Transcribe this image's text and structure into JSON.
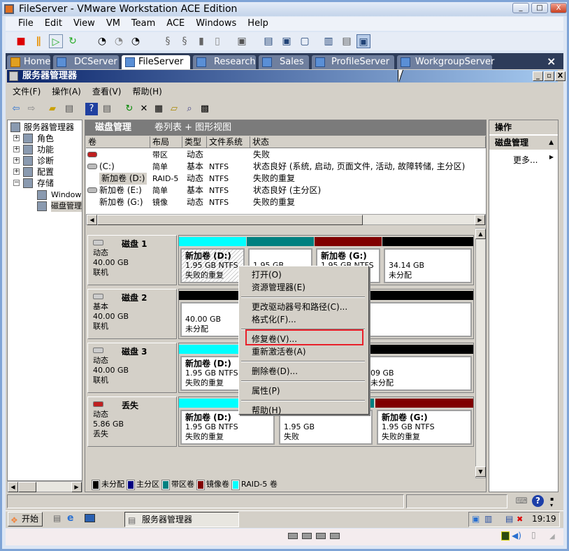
{
  "window": {
    "title": "FileServer - VMware Workstation ACE Edition",
    "min": "_",
    "max": "□",
    "close": "X"
  },
  "menubar": [
    "File",
    "Edit",
    "View",
    "VM",
    "Team",
    "ACE",
    "Windows",
    "Help"
  ],
  "toolbar_icons": [
    "stop-icon",
    "pause-icon",
    "play-icon",
    "reset-icon",
    "snapshot-icon",
    "revert-icon",
    "snapshot-manager-icon",
    "team-icon-1",
    "team-icon-2",
    "device-icon",
    "usb-icon",
    "console-icon",
    "quick-switch-icon",
    "fullscreen-icon",
    "unity-icon",
    "settings-icon",
    "summary-icon",
    "console-view-icon"
  ],
  "tabs": [
    {
      "label": "Home"
    },
    {
      "label": "DCServer"
    },
    {
      "label": "FileServer",
      "active": true
    },
    {
      "label": "Research"
    },
    {
      "label": "Sales"
    },
    {
      "label": "ProfileServer"
    },
    {
      "label": "WorkgroupServer"
    }
  ],
  "tabs_close": "×",
  "app": {
    "title": "服务器管理器",
    "min": "_",
    "restore": "▫",
    "close": "X",
    "menu": [
      "文件(F)",
      "操作(A)",
      "查看(V)",
      "帮助(H)"
    ]
  },
  "tree": {
    "root": "服务器管理器",
    "items": [
      {
        "label": "角色",
        "expander": "+"
      },
      {
        "label": "功能",
        "expander": "+"
      },
      {
        "label": "诊断",
        "expander": "+"
      },
      {
        "label": "配置",
        "expander": "+"
      },
      {
        "label": "存储",
        "expander": "−"
      },
      {
        "label": "Windows"
      },
      {
        "label": "磁盘管理",
        "selected": true
      }
    ]
  },
  "center": {
    "title": "磁盘管理",
    "view": "卷列表 + 图形视图"
  },
  "volume_list": {
    "columns": [
      "卷",
      "布局",
      "类型",
      "文件系统",
      "状态"
    ],
    "rows": [
      {
        "volume": "",
        "layout": "带区",
        "type": "动态",
        "fs": "",
        "status": "失败",
        "icon": "failed-disk-icon"
      },
      {
        "volume": "(C:)",
        "layout": "简单",
        "type": "基本",
        "fs": "NTFS",
        "status": "状态良好 (系统, 启动, 页面文件, 活动, 故障转储, 主分区)",
        "icon": "disk-icon"
      },
      {
        "volume": "新加卷 (D:)",
        "layout": "RAID-5",
        "type": "动态",
        "fs": "NTFS",
        "status": "失败的重复",
        "icon": "",
        "selected": true
      },
      {
        "volume": "新加卷 (E:)",
        "layout": "简单",
        "type": "基本",
        "fs": "NTFS",
        "status": "状态良好 (主分区)",
        "icon": "disk-icon"
      },
      {
        "volume": "新加卷 (G:)",
        "layout": "镜像",
        "type": "动态",
        "fs": "NTFS",
        "status": "失败的重复",
        "icon": ""
      }
    ]
  },
  "colors": {
    "unallocated": "#000000",
    "primary": "#000080",
    "striped": "#008080",
    "mirrored": "#800000",
    "raid5": "#00ffff",
    "highlight": "#e8202a"
  },
  "disks": [
    {
      "name": "磁盘 1",
      "type": "动态",
      "size": "40.00 GB",
      "state": "联机",
      "icon": "disk-icon",
      "partitions": [
        {
          "kind": "raid5",
          "title": "新加卷 (D:)",
          "line2": "1.95 GB NTFS",
          "line3": "失败的重复",
          "selected": true
        },
        {
          "kind": "striped",
          "title": "",
          "line2": "1.95 GB",
          "line3": ""
        },
        {
          "kind": "mirrored",
          "title": "新加卷 (G:)",
          "line2": "1.95 GB NTFS",
          "line3": ""
        },
        {
          "kind": "unallocated",
          "title": "",
          "line2": "34.14 GB",
          "line3": "未分配"
        }
      ]
    },
    {
      "name": "磁盘 2",
      "type": "基本",
      "size": "40.00 GB",
      "state": "联机",
      "icon": "disk-icon",
      "partitions": [
        {
          "kind": "unallocated",
          "title": "",
          "line2": "40.00 GB",
          "line3": "未分配"
        }
      ]
    },
    {
      "name": "磁盘 3",
      "type": "动态",
      "size": "40.00 GB",
      "state": "联机",
      "icon": "disk-icon",
      "partitions": [
        {
          "kind": "raid5",
          "title": "新加卷 (D:)",
          "line2": "1.95 GB NTFS",
          "line3": "失败的重复"
        },
        {
          "kind": "unallocated",
          "title": "",
          "line2": "09 GB",
          "line3": "未分配"
        }
      ]
    },
    {
      "name": "丢失",
      "type": "动态",
      "size": "5.86 GB",
      "state": "丢失",
      "icon": "failed-disk-icon",
      "partitions": [
        {
          "kind": "raid5",
          "title": "新加卷 (D:)",
          "line2": "1.95 GB NTFS",
          "line3": "失败的重复"
        },
        {
          "kind": "striped",
          "title": "",
          "line2": "1.95 GB",
          "line3": "失败"
        },
        {
          "kind": "mirrored",
          "title": "新加卷 (G:)",
          "line2": "1.95 GB NTFS",
          "line3": "失败的重复"
        }
      ]
    }
  ],
  "legend": [
    {
      "label": "未分配",
      "kind": "unallocated"
    },
    {
      "label": "主分区",
      "kind": "primary"
    },
    {
      "label": "带区卷",
      "kind": "striped"
    },
    {
      "label": "镜像卷",
      "kind": "mirrored"
    },
    {
      "label": "RAID-5 卷",
      "kind": "raid5"
    }
  ],
  "actions": {
    "header": "操作",
    "section": "磁盘管理",
    "more": "更多..."
  },
  "context_menu": {
    "groups": [
      [
        "打开(O)",
        "资源管理器(E)"
      ],
      [
        "更改驱动器号和路径(C)...",
        "格式化(F)..."
      ],
      [
        "修复卷(V)...",
        "重新激活卷(A)"
      ],
      [
        "删除卷(D)..."
      ],
      [
        "属性(P)"
      ],
      [
        "帮助(H)"
      ]
    ],
    "highlighted": "修复卷(V)..."
  },
  "taskbar": {
    "start": "开始",
    "task": "服务器管理器",
    "clock": "19:19"
  }
}
